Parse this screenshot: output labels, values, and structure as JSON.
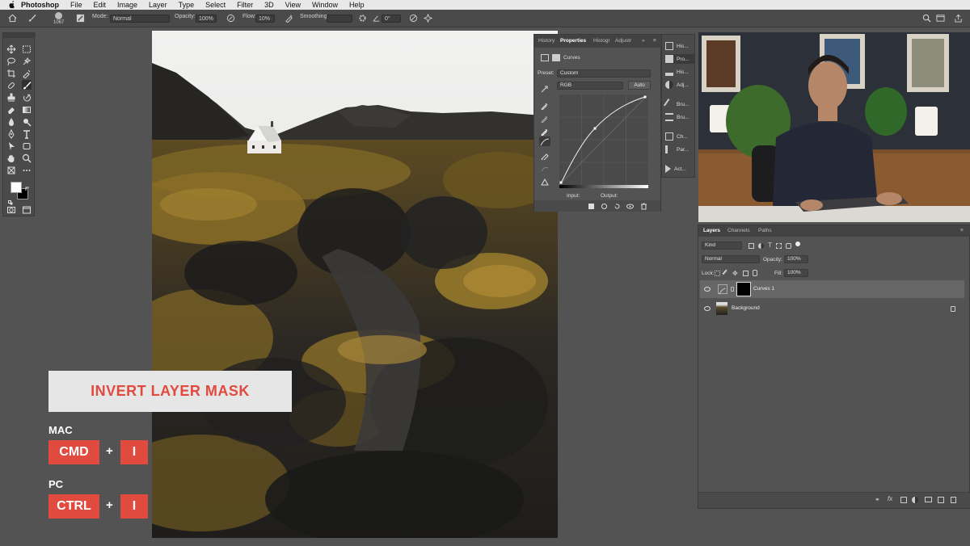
{
  "menubar": {
    "app_name": "Photoshop",
    "items": [
      "File",
      "Edit",
      "Image",
      "Layer",
      "Type",
      "Select",
      "Filter",
      "3D",
      "View",
      "Window",
      "Help"
    ]
  },
  "options_bar": {
    "brush_size": "1067",
    "mode_label": "Mode:",
    "mode_value": "Normal",
    "opacity_label": "Opacity:",
    "opacity_value": "100%",
    "flow_label": "Flow:",
    "flow_value": "10%",
    "smoothing_label": "Smoothing:",
    "angle_value": "0°"
  },
  "properties_panel": {
    "tabs": [
      "History",
      "Properties",
      "Histogr",
      "Adjustr"
    ],
    "active_tab": "Properties",
    "adjustment_name": "Curves",
    "preset_label": "Preset:",
    "preset_value": "Custom",
    "channel_value": "RGB",
    "auto_label": "Auto",
    "input_label": "Input:",
    "output_label": "Output:"
  },
  "dock_panels": [
    "His...",
    "Pro...",
    "His...",
    "Adj...",
    "Bru...",
    "Bru...",
    "Ch...",
    "Par...",
    "Act..."
  ],
  "layers_panel": {
    "tabs": [
      "Layers",
      "Channels",
      "Paths"
    ],
    "active_tab": "Layers",
    "filter_kind": "Kind",
    "blend_mode": "Normal",
    "opacity_label": "Opacity:",
    "opacity_value": "100%",
    "lock_label": "Lock:",
    "fill_label": "Fill:",
    "fill_value": "100%",
    "layers": [
      {
        "name": "Curves 1",
        "selected": true
      },
      {
        "name": "Background",
        "selected": false
      }
    ]
  },
  "overlay": {
    "title": "INVERT LAYER MASK",
    "mac_label": "MAC",
    "mac_keys": [
      "CMD",
      "I"
    ],
    "pc_label": "PC",
    "pc_keys": [
      "CTRL",
      "I"
    ],
    "plus": "+"
  },
  "colors": {
    "accent_red": "#e04a3f",
    "panel_bg": "#535353",
    "banner_bg": "#e6e6e6"
  }
}
